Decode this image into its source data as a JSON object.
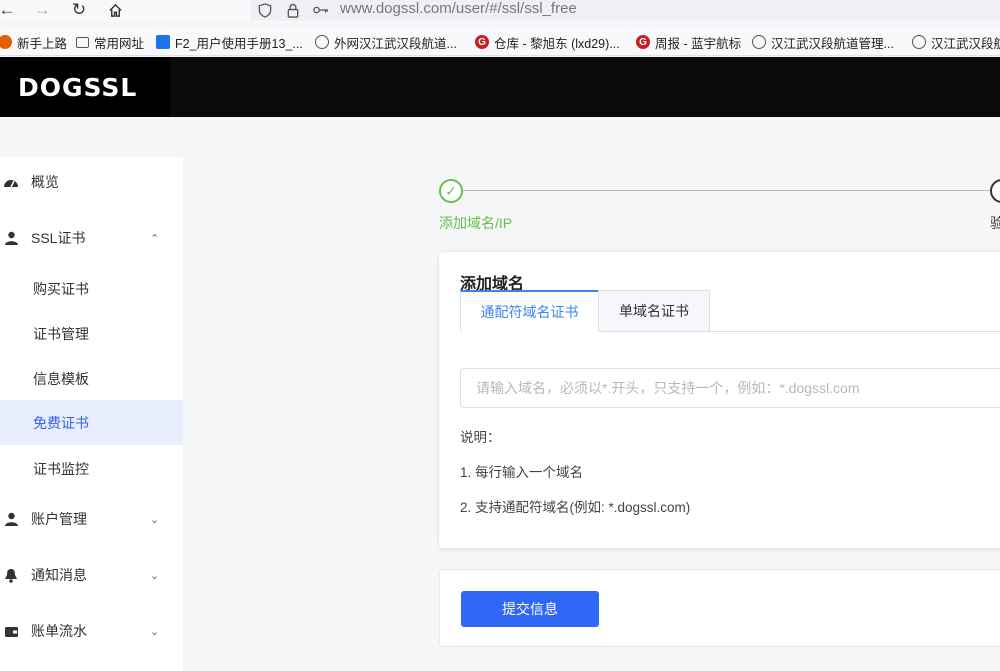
{
  "browser": {
    "url": "www.dogssl.com/user/#/ssl/ssl_free",
    "bookmarks": [
      {
        "label": "新手上路",
        "icon": "firefox-icon",
        "color": "#e66000"
      },
      {
        "label": "常用网址",
        "icon": "folder-icon",
        "color": "#555555"
      },
      {
        "label": "F2_用户使用手册13_...",
        "icon": "doc-icon",
        "color": "#1a73e8"
      },
      {
        "label": "外网汉江武汉段航道...",
        "icon": "globe-icon",
        "color": "#555555"
      },
      {
        "label": "仓库 - 黎旭东 (lxd29)...",
        "icon": "gitee-icon",
        "color": "#c71d23"
      },
      {
        "label": "周报 - 蓝宇航标",
        "icon": "gitee-icon",
        "color": "#c71d23"
      },
      {
        "label": "汉江武汉段航道管理...",
        "icon": "globe-icon",
        "color": "#555555"
      },
      {
        "label": "汉江武汉段航",
        "icon": "globe-icon",
        "color": "#555555"
      }
    ]
  },
  "header": {
    "logo": "DOGSSL"
  },
  "sidebar": {
    "items": [
      {
        "label": "概览",
        "icon": "dashboard-icon"
      },
      {
        "label": "SSL证书",
        "icon": "user-cert-icon",
        "expanded": true
      },
      {
        "label": "购买证书"
      },
      {
        "label": "证书管理"
      },
      {
        "label": "信息模板"
      },
      {
        "label": "免费证书",
        "active": true
      },
      {
        "label": "证书监控"
      },
      {
        "label": "账户管理",
        "icon": "person-icon"
      },
      {
        "label": "通知消息",
        "icon": "bell-icon"
      },
      {
        "label": "账单流水",
        "icon": "wallet-icon"
      }
    ]
  },
  "steps": {
    "step1_label": "添加域名/IP",
    "step2_label": "验",
    "step1_done": true
  },
  "card": {
    "title": "添加域名",
    "tabs": [
      "通配符域名证书",
      "单域名证书"
    ],
    "active_tab": 0,
    "input_placeholder": "请输入域名，必须以*.开头，只支持一个，例如：*.dogssl.com",
    "input_value": "",
    "notes": [
      "说明：",
      "1. 每行输入一个域名",
      "2. 支持通配符域名(例如: *.dogssl.com)"
    ]
  },
  "submit": {
    "label": "提交信息"
  },
  "colors": {
    "accent": "#2f67f6",
    "success": "#6abf4b",
    "active_bg": "#e8eefe"
  }
}
